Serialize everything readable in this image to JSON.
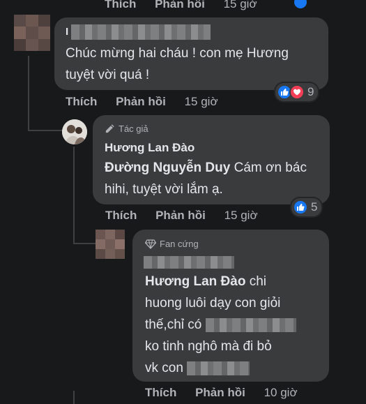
{
  "top_actions": {
    "like": "Thích",
    "reply": "Phản hồi",
    "time": "15 giờ"
  },
  "comment1": {
    "name_partial": "I",
    "text": "Chúc mừng hai cháu ! con mẹ Hương tuyệt vời quá !",
    "reaction_count": "9",
    "actions": {
      "like": "Thích",
      "reply": "Phản hồi",
      "time": "15 giờ"
    }
  },
  "reply1": {
    "badge": "Tác giả",
    "name": "Hương Lan Đào",
    "mention": "Đường Nguyễn Duy",
    "text": " Cám ơn bác hihi, tuyệt vời lắm ạ.",
    "reaction_count": "5",
    "actions": {
      "like": "Thích",
      "reply": "Phản hồi",
      "time": "15 giờ"
    }
  },
  "reply2": {
    "badge": "Fan cứng",
    "mention": "Hương Lan Đào",
    "line1": " chi",
    "line2": "huong luôi dạy con giỏi",
    "line3": "thế,chỉ có",
    "line4": "ko tinh nghô mà đi bỏ",
    "line5": "vk con",
    "actions": {
      "like": "Thích",
      "reply": "Phản hồi",
      "time": "10 giờ"
    }
  },
  "colors": {
    "like_blue": "#1877f2",
    "love_red": "#f33e58",
    "bubble": "#3a3b3c",
    "background": "#18191a"
  }
}
